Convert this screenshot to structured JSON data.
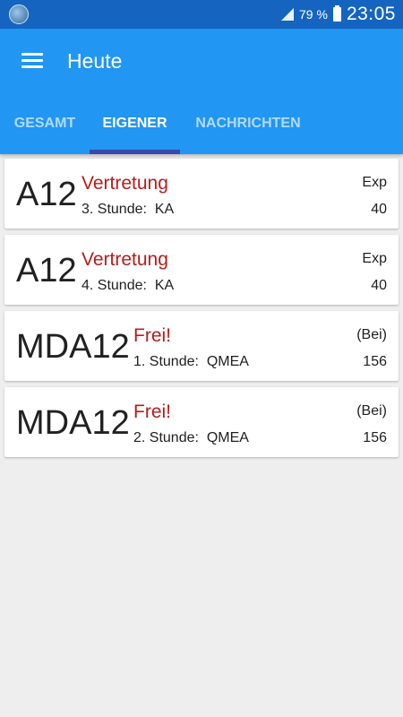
{
  "status_bar": {
    "battery": "79 %",
    "time": "23:05"
  },
  "app_bar": {
    "title": "Heute"
  },
  "tabs": [
    {
      "label": "GESAMT",
      "active": false
    },
    {
      "label": "EIGENER",
      "active": true
    },
    {
      "label": "NACHRICHTEN",
      "active": false
    }
  ],
  "entries": [
    {
      "class": "A12",
      "type": "Vertretung",
      "detail": "3. Stunde:  KA",
      "teacher": "Exp",
      "room": "40"
    },
    {
      "class": "A12",
      "type": "Vertretung",
      "detail": "4. Stunde:  KA",
      "teacher": "Exp",
      "room": "40"
    },
    {
      "class": "MDA12",
      "type": "Frei!",
      "detail": "1. Stunde:  QMEA",
      "teacher": "(Bei)",
      "room": "156"
    },
    {
      "class": "MDA12",
      "type": "Frei!",
      "detail": "2. Stunde:  QMEA",
      "teacher": "(Bei)",
      "room": "156"
    }
  ],
  "colors": {
    "primary": "#2196f3",
    "status_bar": "#1565c0",
    "tab_indicator": "#3949ab",
    "alert_text": "#b71c1c"
  }
}
